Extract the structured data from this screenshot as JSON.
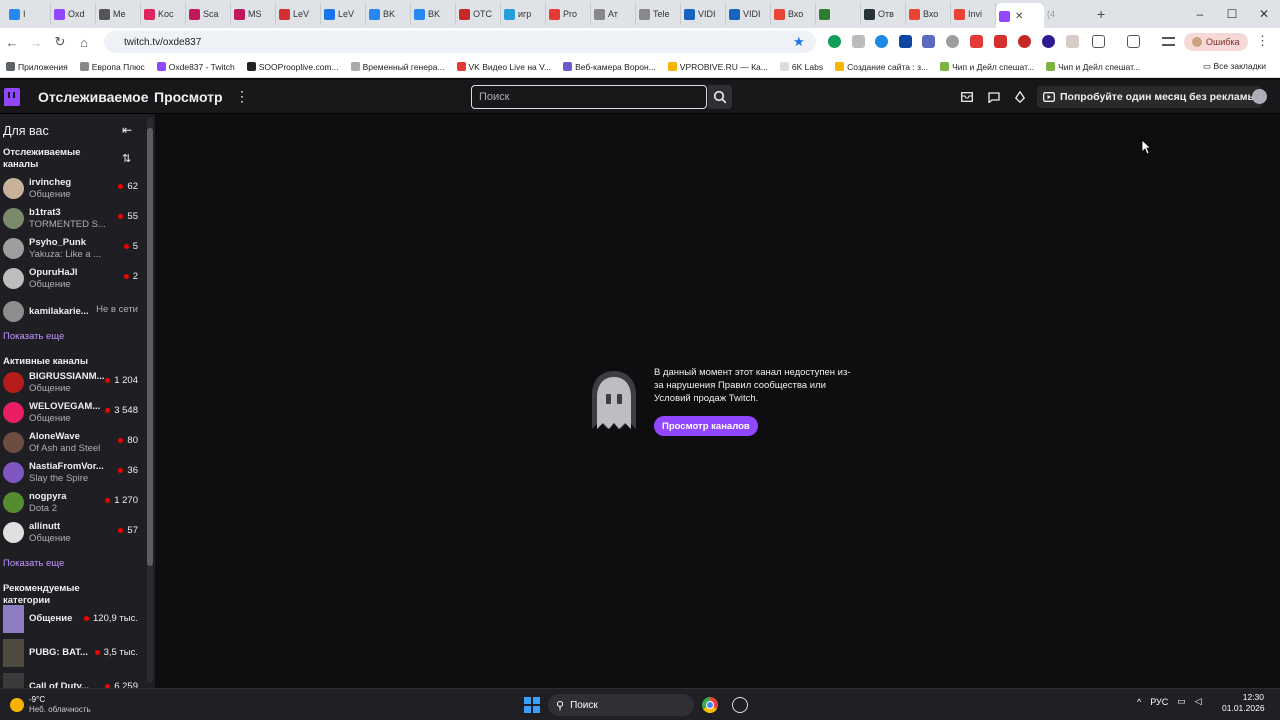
{
  "browser": {
    "tabs": [
      {
        "label": "I",
        "color": "#2787f5",
        "icon": "vk-icon"
      },
      {
        "label": "Oxd",
        "color": "#9147ff",
        "icon": "twitch-icon"
      },
      {
        "label": "Me",
        "color": "#555555",
        "icon": "page-icon"
      },
      {
        "label": "Koc",
        "color": "#e0245e",
        "icon": "page-icon"
      },
      {
        "label": "Sca",
        "color": "#c2185b",
        "icon": "page-icon"
      },
      {
        "label": "MS",
        "color": "#c2185b",
        "icon": "page-icon"
      },
      {
        "label": "LeV",
        "color": "#d32f2f",
        "icon": "page-icon"
      },
      {
        "label": "LeV",
        "color": "#1a73e8",
        "icon": "page-icon"
      },
      {
        "label": "BK",
        "color": "#2787f5",
        "icon": "vk-icon"
      },
      {
        "label": "BK",
        "color": "#2787f5",
        "icon": "vk-icon"
      },
      {
        "label": "OTC",
        "color": "#c62828",
        "icon": "page-icon"
      },
      {
        "label": "игр",
        "color": "#229ed9",
        "icon": "telegram-icon"
      },
      {
        "label": "Pro",
        "color": "#e53935",
        "icon": "page-icon"
      },
      {
        "label": "Ат",
        "color": "#888888",
        "icon": "page-icon"
      },
      {
        "label": "Tele",
        "color": "#888888",
        "icon": "page-icon"
      },
      {
        "label": "VIDI",
        "color": "#1565c0",
        "icon": "page-icon"
      },
      {
        "label": "VIDI",
        "color": "#1565c0",
        "icon": "page-icon"
      },
      {
        "label": "Вхо",
        "color": "#ea4335",
        "icon": "gmail-icon"
      },
      {
        "label": "",
        "color": "#2e7d32",
        "icon": "page-icon"
      },
      {
        "label": "Отв",
        "color": "#263238",
        "icon": "page-icon"
      },
      {
        "label": "Вхо",
        "color": "#ea4335",
        "icon": "gmail-icon"
      },
      {
        "label": "Invi",
        "color": "#ea4335",
        "icon": "gmail-icon"
      }
    ],
    "active_tab": {
      "color": "#9147ff",
      "close": "✕"
    },
    "extra_tab_label": "(4",
    "new_tab": "+",
    "url": "twitch.tv/oxde837",
    "profile_label": "Ошибка",
    "bookmarks": [
      {
        "label": "Приложения",
        "color": "#5f6368"
      },
      {
        "label": "Европа Плюс",
        "color": "#888888"
      },
      {
        "label": "Oxde837 - Twitch",
        "color": "#9147ff"
      },
      {
        "label": "SOOProoplive.com...",
        "color": "#222222"
      },
      {
        "label": "Временный генера...",
        "color": "#aaaaaa"
      },
      {
        "label": "VK Видео Live на V...",
        "color": "#e53935"
      },
      {
        "label": "Веб-камера Ворон...",
        "color": "#6a5acd"
      },
      {
        "label": "VPROBIVE.RU — Ка...",
        "color": "#f5b400"
      },
      {
        "label": "6K Labs",
        "color": "#dddddd"
      },
      {
        "label": "Создание сайта : з...",
        "color": "#f5b400"
      },
      {
        "label": "Чип и Дейл спешат...",
        "color": "#7cb342"
      },
      {
        "label": "Чип и Дейл спешат...",
        "color": "#7cb342"
      }
    ],
    "all_bookmarks": "Все закладки"
  },
  "twitch": {
    "nav": {
      "following": "Отслеживаемое",
      "browse": "Просмотр",
      "more": "⋮"
    },
    "search_placeholder": "Поиск",
    "ad_free": "Попробуйте один месяц без рекламы",
    "sidebar": {
      "title": "Для вас",
      "followed_title": "Отслеживаемые каналы",
      "followed": [
        {
          "name": "irvincheg",
          "game": "Общение",
          "viewers": "62",
          "avatar": "#c7b299"
        },
        {
          "name": "b1trat3",
          "game": "TORMENTED S...",
          "viewers": "55",
          "avatar": "#7b8a6a"
        },
        {
          "name": "Psyho_Punk",
          "game": "Yakuza: Like a ...",
          "viewers": "5",
          "avatar": "#9e9e9e"
        },
        {
          "name": "OpuruHaJl",
          "game": "Общение",
          "viewers": "2",
          "avatar": "#bdbdbd"
        }
      ],
      "offline": {
        "name": "kamilakarie...",
        "status": "Не в сети",
        "avatar": "#8d8d8d"
      },
      "show_more": "Показать еще",
      "active_title": "Активные каналы",
      "active": [
        {
          "name": "BIGRUSSIANM...",
          "game": "Общение",
          "viewers": "1 204",
          "avatar": "#b71c1c"
        },
        {
          "name": "WELOVEGAM...",
          "game": "Общение",
          "viewers": "3 548",
          "avatar": "#e91e63"
        },
        {
          "name": "AloneWave",
          "game": "Of Ash and Steel",
          "viewers": "80",
          "avatar": "#6d4c41"
        },
        {
          "name": "NastiaFromVor...",
          "game": "Slay the Spire",
          "viewers": "36",
          "avatar": "#7e57c2"
        },
        {
          "name": "nogpyra",
          "game": "Dota 2",
          "viewers": "1 270",
          "avatar": "#558b2f"
        },
        {
          "name": "allinutt",
          "game": "Общение",
          "viewers": "57",
          "avatar": "#e0e0e0"
        }
      ],
      "show_more_2": "Показать еще",
      "categories_title": "Рекомендуемые категории",
      "categories": [
        {
          "name": "Общение",
          "viewers": "120,9 тыс.",
          "thumb": "#8e7cc3"
        },
        {
          "name": "PUBG: BAT...",
          "viewers": "3,5 тыс.",
          "thumb": "#4e4a3f"
        },
        {
          "name": "Call of Duty...",
          "viewers": "6 259",
          "thumb": "#3b3b3b"
        }
      ]
    },
    "unavailable_message": "В данный момент этот канал недоступен из-за нарушения Правил сообщества или Условий продаж Twitch.",
    "browse_button": "Просмотр каналов",
    "accent": "#9147ff"
  },
  "taskbar": {
    "temp": "-9°C",
    "weather": "Неб. облачность",
    "search": "Поиск",
    "lang": "РУС",
    "time": "12:30",
    "date": "01.01.2026"
  }
}
